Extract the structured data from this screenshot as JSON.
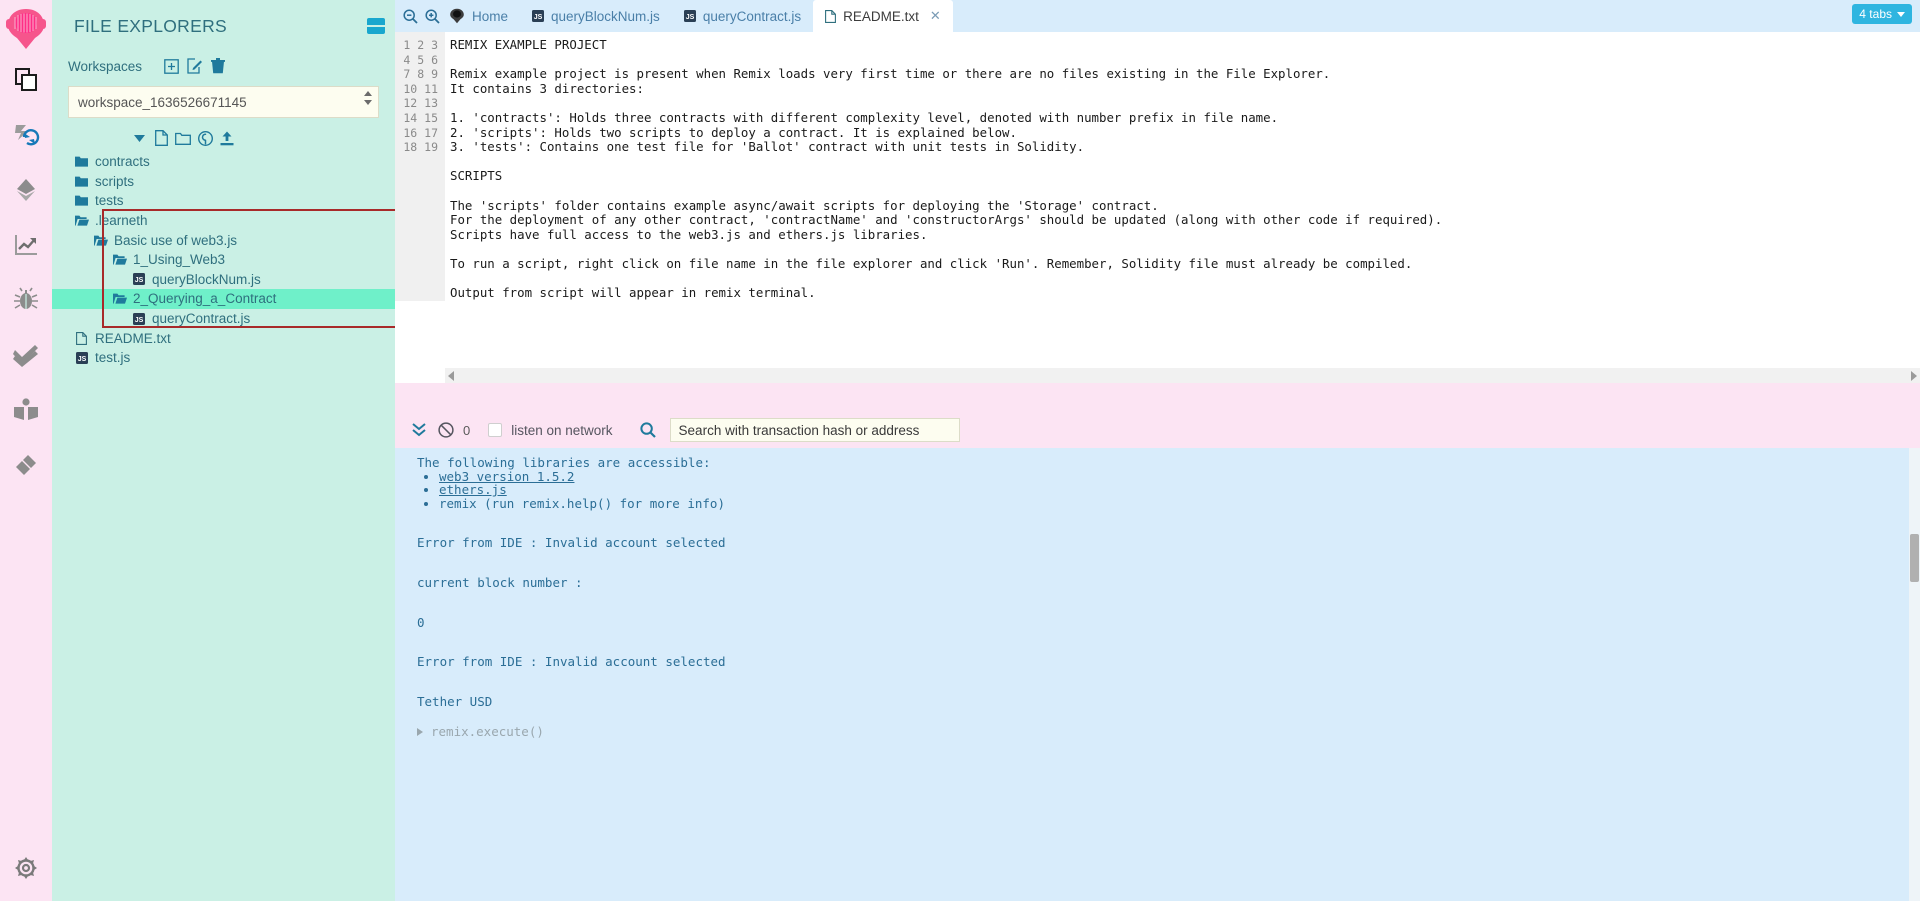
{
  "icon_rail": {
    "logo": "remix-logo-icon",
    "items": [
      {
        "name": "file-explorer-icon",
        "title": "File explorer"
      },
      {
        "name": "deploy-run-icon",
        "title": "Deploy and run transactions"
      },
      {
        "name": "solidity-compiler-icon",
        "title": "Solidity compiler"
      },
      {
        "name": "analysis-chart-icon",
        "title": "Solidity analyzers"
      },
      {
        "name": "debugger-bug-icon",
        "title": "Debugger"
      },
      {
        "name": "unit-testing-check-icon",
        "title": "Solidity unit testing"
      },
      {
        "name": "learneth-book-icon",
        "title": "LearnEth"
      },
      {
        "name": "plugin-manager-plug-icon",
        "title": "Plugin manager"
      }
    ],
    "bottom": {
      "name": "settings-gear-icon",
      "title": "Settings"
    }
  },
  "explorer": {
    "title": "FILE EXPLORERS",
    "collapse_icon": "collapse-panel-icon",
    "workspaces_label": "Workspaces",
    "workspace_actions": [
      {
        "name": "create-workspace-icon",
        "glyph": "plus-square"
      },
      {
        "name": "rename-workspace-icon",
        "glyph": "pencil-square"
      },
      {
        "name": "delete-workspace-icon",
        "glyph": "trash"
      }
    ],
    "workspace_selected": "workspace_1636526671145",
    "tree_toolbar": [
      {
        "name": "tree-collapse-caret-icon",
        "glyph": "caret-down"
      },
      {
        "name": "new-file-icon",
        "glyph": "file"
      },
      {
        "name": "new-folder-icon",
        "glyph": "folder"
      },
      {
        "name": "publish-to-gist-icon",
        "glyph": "github"
      },
      {
        "name": "upload-file-icon",
        "glyph": "upload"
      }
    ],
    "tree": [
      {
        "label": "contracts",
        "type": "folder-closed",
        "depth": 1,
        "selected": false
      },
      {
        "label": "scripts",
        "type": "folder-closed",
        "depth": 1,
        "selected": false
      },
      {
        "label": "tests",
        "type": "folder-closed",
        "depth": 1,
        "selected": false
      },
      {
        "label": ".learneth",
        "type": "folder-open",
        "depth": 1,
        "selected": false
      },
      {
        "label": "Basic use of web3.js",
        "type": "folder-open",
        "depth": 2,
        "selected": false
      },
      {
        "label": "1_Using_Web3",
        "type": "folder-open",
        "depth": 3,
        "selected": false
      },
      {
        "label": "queryBlockNum.js",
        "type": "file-js",
        "depth": 4,
        "selected": false
      },
      {
        "label": "2_Querying_a_Contract",
        "type": "folder-open",
        "depth": 3,
        "selected": true
      },
      {
        "label": "queryContract.js",
        "type": "file-js",
        "depth": 4,
        "selected": false
      },
      {
        "label": "README.txt",
        "type": "file-txt",
        "depth": 1,
        "selected": false
      },
      {
        "label": "test.js",
        "type": "file-js",
        "depth": 1,
        "selected": false
      }
    ],
    "highlight_color": "#a82a2a",
    "selection_color": "#6ff0c9"
  },
  "tabbar": {
    "zoom_out_icon": "zoom-out-icon",
    "zoom_in_icon": "zoom-in-icon",
    "tabs": [
      {
        "label": "Home",
        "icon": "remix-home-icon",
        "active": false,
        "closable": false
      },
      {
        "label": "queryBlockNum.js",
        "icon": "js-file-icon",
        "active": false,
        "closable": false
      },
      {
        "label": "queryContract.js",
        "icon": "js-file-icon",
        "active": false,
        "closable": false
      },
      {
        "label": "README.txt",
        "icon": "txt-file-icon",
        "active": true,
        "closable": true
      }
    ],
    "close_glyph": "✕",
    "tabs_count_label": "4 tabs"
  },
  "editor": {
    "filename": "README.txt",
    "line_numbers": [
      "1",
      "2",
      "3",
      "4",
      "5",
      "6",
      "7",
      "8",
      "9",
      "10",
      "11",
      "12",
      "13",
      "14",
      "15",
      "16",
      "17",
      "18",
      "19"
    ],
    "lines": [
      "REMIX EXAMPLE PROJECT",
      "",
      "Remix example project is present when Remix loads very first time or there are no files existing in the File Explorer.",
      "It contains 3 directories:",
      "",
      "1. 'contracts': Holds three contracts with different complexity level, denoted with number prefix in file name.",
      "2. 'scripts': Holds two scripts to deploy a contract. It is explained below.",
      "3. 'tests': Contains one test file for 'Ballot' contract with unit tests in Solidity.",
      "",
      "SCRIPTS",
      "",
      "The 'scripts' folder contains example async/await scripts for deploying the 'Storage' contract.",
      "For the deployment of any other contract, 'contractName' and 'constructorArgs' should be updated (along with other code if required).",
      "Scripts have full access to the web3.js and ethers.js libraries.",
      "",
      "To run a script, right click on file name in the file explorer and click 'Run'. Remember, Solidity file must already be compiled.",
      "",
      "Output from script will appear in remix terminal.",
      ""
    ]
  },
  "terminal": {
    "toggle_icon": "chevrons-down-icon",
    "clear_icon": "clear-console-icon",
    "pending_count": "0",
    "listen_checkbox_checked": false,
    "listen_label": "listen on network",
    "search_icon": "search-icon",
    "search_placeholder": "Search with transaction hash or address",
    "search_value": "",
    "output": {
      "intro": "The following libraries are accessible:",
      "libraries": [
        {
          "text": "web3 version 1.5.2",
          "link": true
        },
        {
          "text": "ethers.js",
          "link": true
        },
        {
          "text": "remix (run remix.help() for more info)",
          "link": false
        }
      ],
      "messages": [
        "Error from IDE : Invalid account selected",
        "current block number :",
        "0",
        "Error from IDE : Invalid account selected",
        "Tether USD"
      ],
      "prompt": "remix.execute()"
    }
  },
  "colors": {
    "rail_bg": "#fce4f3",
    "explorer_bg": "#caf0e5",
    "tabbar_bg": "#d8ecfb",
    "terminal_bg": "#d8ecfb",
    "terminal_toolbar_bg": "#fce4f3",
    "accent_teal": "#2f6f7e",
    "badge_blue": "#2fb5e0"
  }
}
